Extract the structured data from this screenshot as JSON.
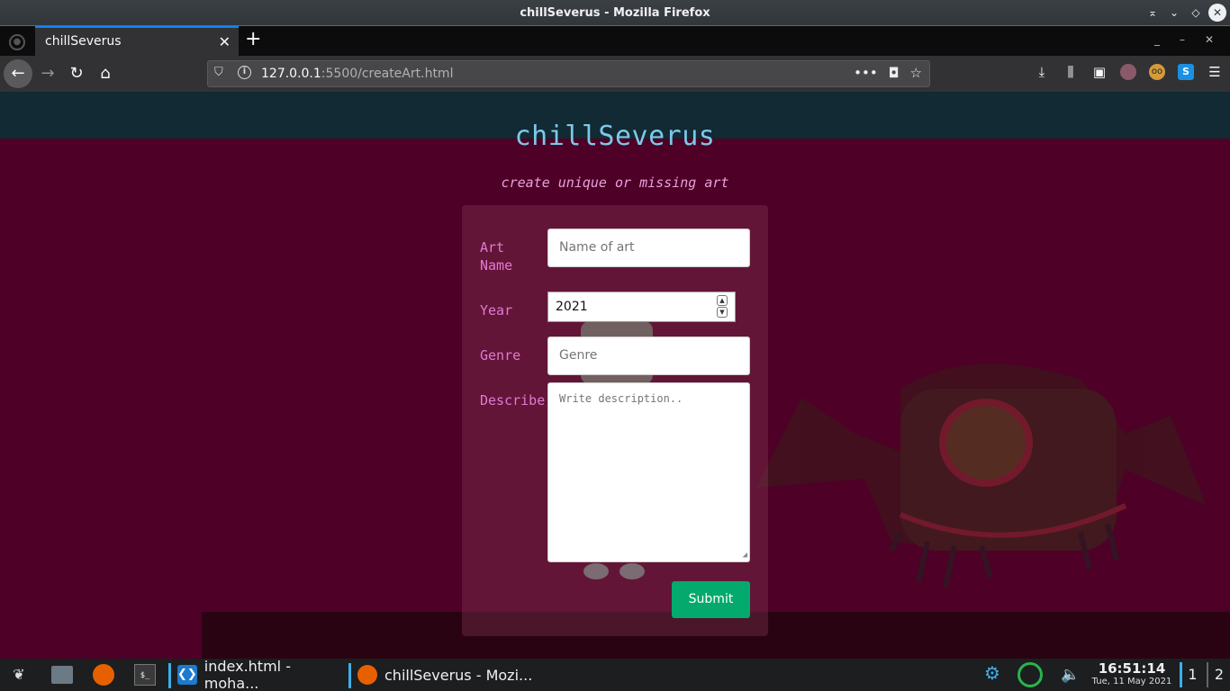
{
  "window": {
    "title": "chillSeverus - Mozilla Firefox"
  },
  "tabs": [
    {
      "title": "chillSeverus",
      "active": true
    }
  ],
  "navbar": {
    "url_host": "127.0.0.1",
    "url_rest": ":5500/createArt.html"
  },
  "page": {
    "site_title": "chillSeverus",
    "subtitle": "create unique or missing art",
    "form": {
      "art_name_label": "Art Name",
      "art_name_placeholder": "Name of art",
      "year_label": "Year",
      "year_value": "2021",
      "genre_label": "Genre",
      "genre_placeholder": "Genre",
      "describe_label": "Describe",
      "describe_placeholder": "Write description..",
      "submit_label": "Submit"
    },
    "colors": {
      "background": "#4e0026",
      "title": "#7ec8e8",
      "label": "#e07ad4",
      "submit": "#04aa6d"
    }
  },
  "taskbar": {
    "tasks": [
      {
        "label": "index.html - moha..."
      },
      {
        "label": "chillSeverus - Mozi..."
      }
    ],
    "clock": {
      "time": "16:51:14",
      "date": "Tue, 11 May 2021"
    },
    "desktops": [
      "1",
      "2"
    ]
  }
}
